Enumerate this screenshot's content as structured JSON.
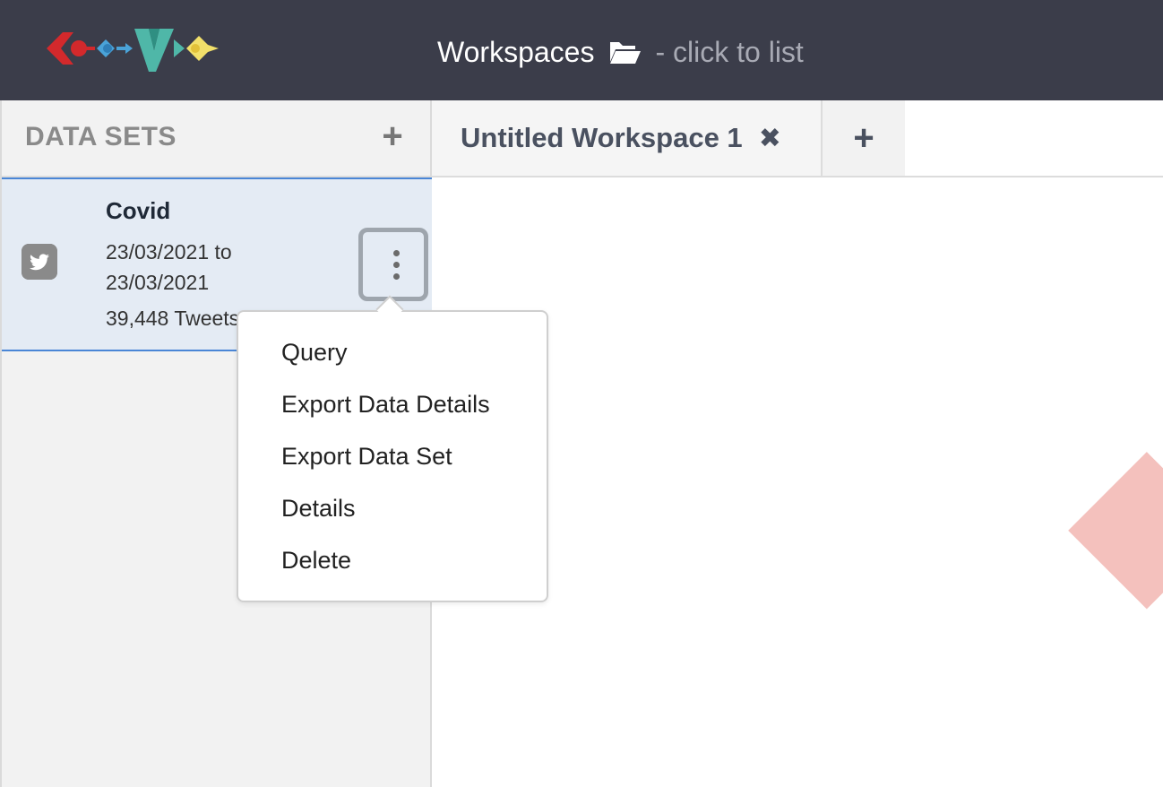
{
  "header": {
    "title": "Workspaces",
    "hint": "- click to list",
    "logo_icon": "cosmos-logo",
    "folder_icon": "folder-open-icon"
  },
  "sidebar": {
    "title": "DATA SETS",
    "add_label": "+",
    "datasets": [
      {
        "name": "Covid",
        "date_from": "23/03/2021 to",
        "date_to": "23/03/2021",
        "count": "39,448 Tweets",
        "icon": "twitter-icon"
      }
    ]
  },
  "tabs": {
    "items": [
      {
        "label": "Untitled Workspace 1",
        "close": "✖"
      }
    ],
    "add_label": "+"
  },
  "menu": {
    "items": [
      "Query",
      "Export Data Details",
      "Export Data Set",
      "Details",
      "Delete"
    ]
  },
  "colors": {
    "header_bg": "#3b3d4a",
    "accent_blue": "#4a86d6",
    "selected_bg": "#e4ebf4",
    "diamond": "#f4c1bd"
  }
}
